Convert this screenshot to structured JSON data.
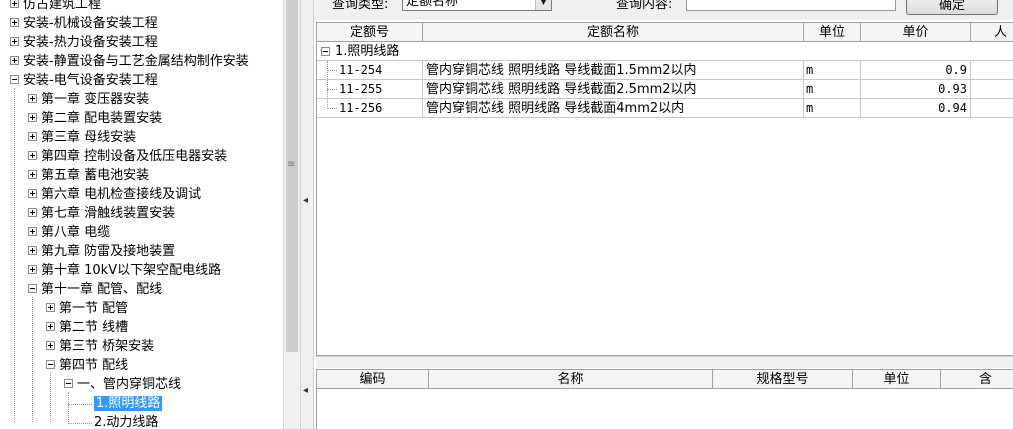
{
  "tree": {
    "nodes": [
      {
        "label": "仿古建筑工程",
        "toggle": "plus"
      },
      {
        "label": "安装-机械设备安装工程",
        "toggle": "plus"
      },
      {
        "label": "安装-热力设备安装工程",
        "toggle": "plus"
      },
      {
        "label": "安装-静置设备与工艺金属结构制作安装",
        "toggle": "plus"
      },
      {
        "label": "安装-电气设备安装工程",
        "toggle": "minus"
      },
      {
        "label": "第一章 变压器安装",
        "toggle": "plus"
      },
      {
        "label": "第二章 配电装置安装",
        "toggle": "plus"
      },
      {
        "label": "第三章 母线安装",
        "toggle": "plus"
      },
      {
        "label": "第四章 控制设备及低压电器安装",
        "toggle": "plus"
      },
      {
        "label": "第五章 蓄电池安装",
        "toggle": "plus"
      },
      {
        "label": "第六章 电机检查接线及调试",
        "toggle": "plus"
      },
      {
        "label": "第七章 滑触线装置安装",
        "toggle": "plus"
      },
      {
        "label": "第八章 电缆",
        "toggle": "plus"
      },
      {
        "label": "第九章 防雷及接地装置",
        "toggle": "plus"
      },
      {
        "label": "第十章 10kV以下架空配电线路",
        "toggle": "plus"
      },
      {
        "label": "第十一章 配管、配线",
        "toggle": "minus"
      },
      {
        "label": "第一节 配管",
        "toggle": "plus"
      },
      {
        "label": "第二节 线槽",
        "toggle": "plus"
      },
      {
        "label": "第三节 桥架安装",
        "toggle": "plus"
      },
      {
        "label": "第四节 配线",
        "toggle": "minus"
      },
      {
        "label": "一、管内穿铜芯线",
        "toggle": "minus"
      },
      {
        "label": "1.照明线路",
        "toggle": "none",
        "selected": true
      },
      {
        "label": "2.动力线路",
        "toggle": "none"
      }
    ]
  },
  "query": {
    "type_label": "查询类型:",
    "type_value": "定额名称",
    "content_label": "查询内容:",
    "content_value": "",
    "ok_button": "确定"
  },
  "grid1": {
    "columns": [
      "定额号",
      "定额名称",
      "单位",
      "单价",
      "人"
    ],
    "group": "1.照明线路",
    "rows": [
      {
        "code": "11-254",
        "name": "管内穿铜芯线 照明线路 导线截面1.5mm2以内",
        "unit": "m",
        "price": "0.9"
      },
      {
        "code": "11-255",
        "name": "管内穿铜芯线 照明线路 导线截面2.5mm2以内",
        "unit": "m",
        "price": "0.93"
      },
      {
        "code": "11-256",
        "name": "管内穿铜芯线 照明线路 导线截面4mm2以内",
        "unit": "m",
        "price": "0.94"
      }
    ]
  },
  "grid2": {
    "columns": [
      "编码",
      "名称",
      "规格型号",
      "单位",
      "含"
    ]
  },
  "icons": {
    "tree_plus": "plus-box-icon",
    "tree_minus": "minus-box-icon",
    "splitter_arrow": "chevron-left-icon",
    "dropdown": "chevron-down-icon"
  },
  "colors": {
    "selection": "#3399ff",
    "header_bg": "#f4f4f4",
    "chrome": "#f0f0f0"
  }
}
